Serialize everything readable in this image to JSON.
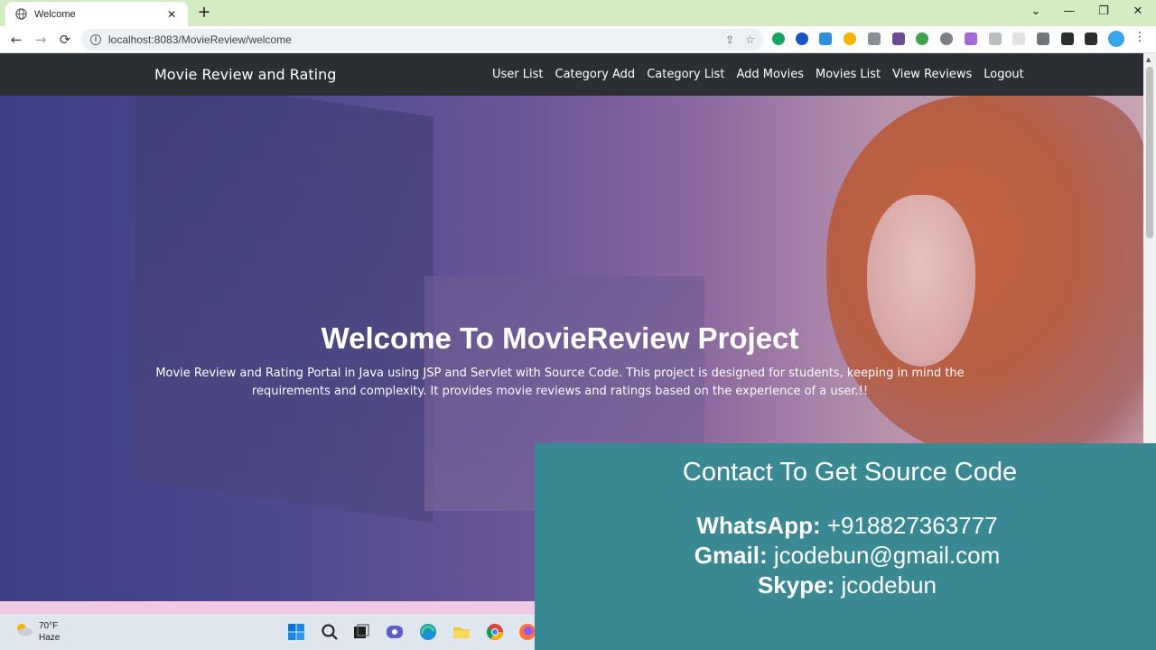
{
  "browser": {
    "tab_title": "Welcome",
    "tab_close": "✕",
    "new_tab": "+",
    "url": "localhost:8083/MovieReview/welcome",
    "controls": {
      "dropdown": "⌄",
      "minimize": "—",
      "restore": "❐",
      "close": "✕"
    },
    "back": "←",
    "forward": "→",
    "reload": "⟳",
    "menu": "⋮"
  },
  "navbar": {
    "brand": "Movie Review and Rating",
    "links": [
      {
        "label": "User List"
      },
      {
        "label": "Category Add"
      },
      {
        "label": "Category List"
      },
      {
        "label": "Add Movies"
      },
      {
        "label": "Movies List"
      },
      {
        "label": "View Reviews"
      },
      {
        "label": "Logout"
      }
    ]
  },
  "hero": {
    "title": "Welcome To MovieReview Project",
    "description": "Movie Review and Rating Portal in Java using JSP and Servlet with Source Code. This project is designed for students, keeping in mind the requirements and complexity. It provides movie reviews and ratings based on the experience of a user.!!"
  },
  "contact": {
    "heading": "Contact To Get Source Code",
    "whatsapp_label": "WhatsApp:",
    "whatsapp_value": "+918827363777",
    "gmail_label": "Gmail:",
    "gmail_value": "jcodebun@gmail.com",
    "skype_label": "Skype:",
    "skype_value": "jcodebun"
  },
  "taskbar": {
    "temperature": "70°F",
    "condition": "Haze"
  },
  "colors": {
    "tabstrip": "#d3ecc4",
    "navbar": "#2b2f33",
    "contact_panel": "#3a8893"
  }
}
